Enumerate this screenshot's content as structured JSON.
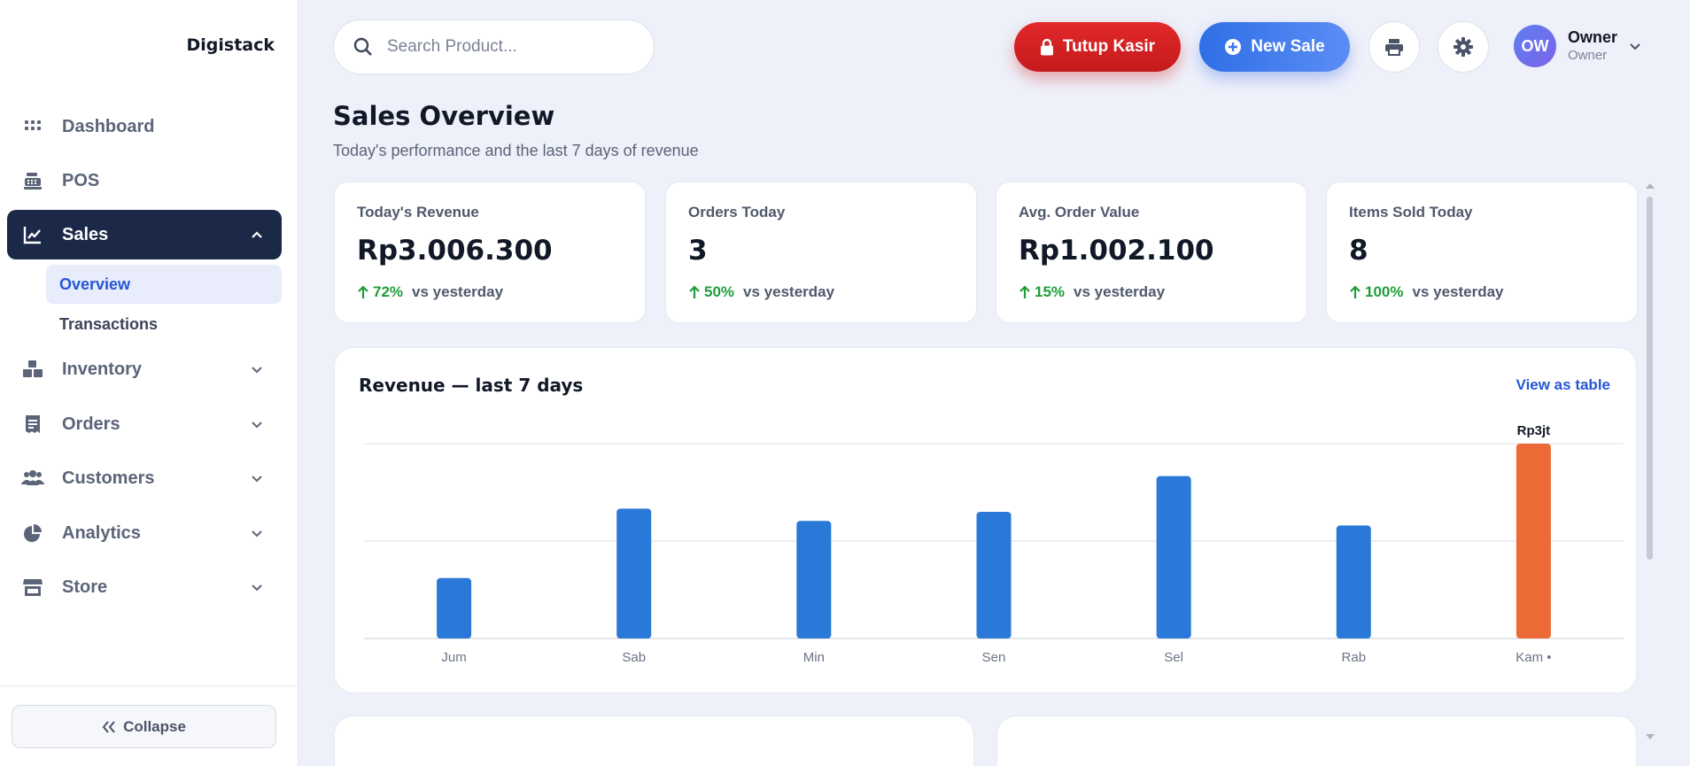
{
  "brand": "Digistack",
  "sidebar": {
    "items": [
      {
        "label": "Dashboard"
      },
      {
        "label": "POS"
      },
      {
        "label": "Sales",
        "sub": [
          {
            "label": "Overview"
          },
          {
            "label": "Transactions"
          }
        ]
      },
      {
        "label": "Inventory"
      },
      {
        "label": "Orders"
      },
      {
        "label": "Customers"
      },
      {
        "label": "Analytics"
      },
      {
        "label": "Store"
      }
    ],
    "collapse_label": "Collapse"
  },
  "topbar": {
    "search_placeholder": "Search Product...",
    "close_register_label": "Tutup Kasir",
    "new_sale_label": "New Sale",
    "user": {
      "initials": "OW",
      "name": "Owner",
      "role": "Owner"
    }
  },
  "page": {
    "title": "Sales Overview",
    "subtitle": "Today's performance and the last 7 days of revenue"
  },
  "stats": [
    {
      "label": "Today's Revenue",
      "value": "Rp3.006.300",
      "delta": "72%",
      "compare": "vs yesterday"
    },
    {
      "label": "Orders Today",
      "value": "3",
      "delta": "50%",
      "compare": "vs yesterday"
    },
    {
      "label": "Avg. Order Value",
      "value": "Rp1.002.100",
      "delta": "15%",
      "compare": "vs yesterday"
    },
    {
      "label": "Items Sold Today",
      "value": "8",
      "delta": "100%",
      "compare": "vs yesterday"
    }
  ],
  "panel": {
    "title": "Revenue — last 7 days",
    "link": "View as table"
  },
  "colors": {
    "accent": "#2657d6",
    "bar": "#2a78d8",
    "bar_today": "#ec6a36",
    "positive": "#1f9d3a",
    "danger": "#d62022",
    "sidebar_active": "#1c2847"
  },
  "chart_data": {
    "type": "bar",
    "categories": [
      "Jum",
      "Sab",
      "Min",
      "Sen",
      "Sel",
      "Rab",
      "Kam •"
    ],
    "values": [
      0.93,
      2.0,
      1.81,
      1.95,
      2.5,
      1.74,
      3.0
    ],
    "unit": "juta Rp",
    "highlight_index": 6,
    "highlight_label": "Rp3jt",
    "ylim": [
      0,
      3
    ],
    "grid": true
  }
}
